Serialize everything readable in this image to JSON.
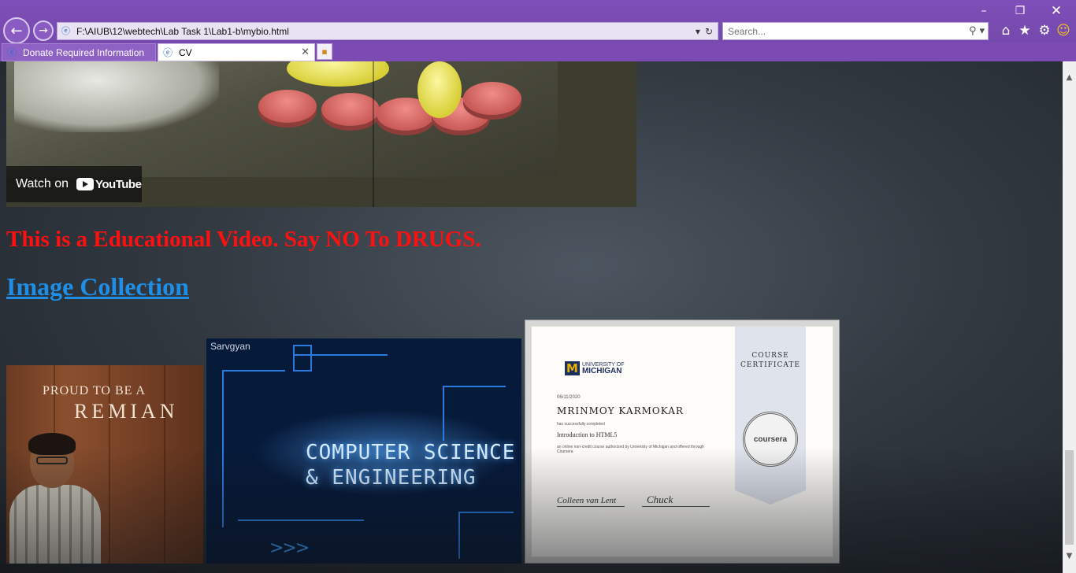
{
  "browser": {
    "address": "F:\\AIUB\\12\\webtech\\Lab Task 1\\Lab1-b\\mybio.html",
    "search_placeholder": "Search...",
    "tabs": [
      {
        "label": "Donate Required Information",
        "active": false
      },
      {
        "label": "CV",
        "active": true
      }
    ],
    "toolbar_icons": [
      "home-icon",
      "favorites-star-icon",
      "settings-gear-icon",
      "smiley-feedback-icon"
    ],
    "window_controls": [
      "minimize",
      "restore",
      "close"
    ]
  },
  "page": {
    "video": {
      "watch_on": "Watch on",
      "brand": "YouTube"
    },
    "warning_text": "This is a Educational Video. Say NO To DRUGS.",
    "warning_color": "#ff1010",
    "image_collection_link": "Image Collection",
    "link_color": "#1e8fe8",
    "images": {
      "photo": {
        "line1": "PROUD TO BE A",
        "line2": "REMIAN"
      },
      "cse_banner": {
        "brand": "Sarvgyan",
        "line1": "COMPUTER SCIENCE",
        "line2": "& ENGINEERING",
        "arrows": ">>>"
      },
      "certificate": {
        "ribbon_line1": "COURSE",
        "ribbon_line2": "CERTIFICATE",
        "seal": "coursera",
        "university_small": "UNIVERSITY OF",
        "university_big": "MICHIGAN",
        "date": "06/11/2020",
        "name": "MRINMOY KARMOKAR",
        "completed": "has successfully completed",
        "course": "Introduction to HTML5",
        "desc": "an online non-credit course authorized by University of Michigan and offered through Coursera",
        "sig1": "Colleen van Lent",
        "sig2": "Chuck"
      }
    }
  },
  "scrollbar": {
    "thumb_position_fraction": 0.78
  }
}
